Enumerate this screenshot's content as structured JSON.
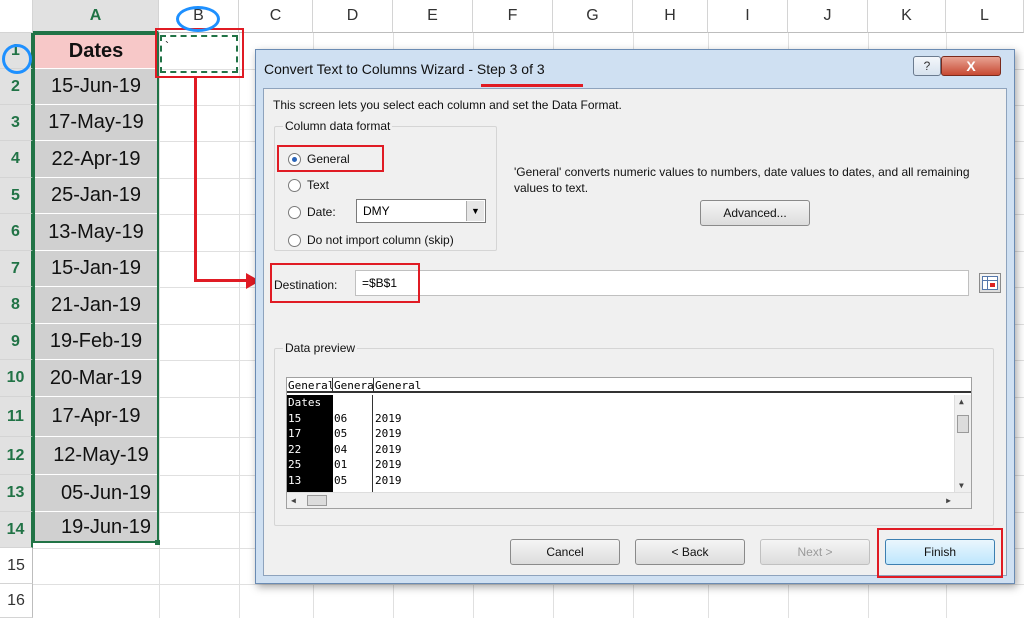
{
  "sheet": {
    "columns": [
      "A",
      "B",
      "C",
      "D",
      "E",
      "F",
      "G",
      "H",
      "I",
      "J",
      "K",
      "L"
    ],
    "rows": [
      "1",
      "2",
      "3",
      "4",
      "5",
      "6",
      "7",
      "8",
      "9",
      "10",
      "11",
      "12",
      "13",
      "14",
      "15",
      "16"
    ],
    "column_a": [
      "Dates",
      "15-Jun-19",
      "17-May-19",
      "22-Apr-19",
      "25-Jan-19",
      "13-May-19",
      "15-Jan-19",
      "21-Jan-19",
      "19-Feb-19",
      "20-Mar-19",
      "17-Apr-19",
      "12-May-19",
      "05-Jun-19",
      "19-Jun-19"
    ],
    "b1_value": "`"
  },
  "dialog": {
    "title_prefix": "Convert Text to Columns Wizard - ",
    "title_step": "Step 3 of 3",
    "help_label": "?",
    "close_label": "X",
    "description": "This screen lets you select each column and set the Data Format.",
    "format_group_label": "Column data format",
    "radio_general": "General",
    "radio_text": "Text",
    "radio_date": "Date:",
    "date_format": "DMY",
    "radio_skip": "Do not import column (skip)",
    "explanation": "'General' converts numeric values to numbers, date values to dates, and all remaining values to text.",
    "advanced_button": "Advanced...",
    "destination_label": "Destination:",
    "destination_value": "=$B$1",
    "preview_label": "Data preview",
    "preview_headers": [
      "General",
      "General",
      "General"
    ],
    "preview_col0": [
      "Dates",
      "15",
      "17",
      "22",
      "25",
      "13"
    ],
    "preview_col1": [
      "",
      "06",
      "05",
      "04",
      "01",
      "05"
    ],
    "preview_col2": [
      "",
      "2019",
      "2019",
      "2019",
      "2019",
      "2019"
    ],
    "cancel_button": "Cancel",
    "back_button": "< Back",
    "next_button": "Next >",
    "finish_button": "Finish"
  },
  "colors": {
    "annotation_red": "#e01b24",
    "annotation_blue": "#1e90ff",
    "excel_green": "#217346"
  }
}
